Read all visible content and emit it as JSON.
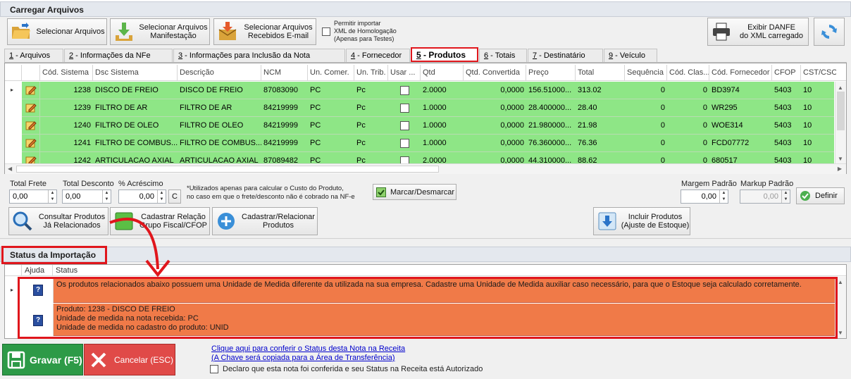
{
  "header": {
    "title": "Carregar Arquivos"
  },
  "toolbar": {
    "selecionar": "Selecionar Arquivos",
    "manifestacao": "Selecionar Arquivos\nManifestação",
    "email": "Selecionar Arquivos\nRecebidos E-mail",
    "permitir": "Permitir importar\nXML de Homologação\n(Apenas para Testes)",
    "danfe": "Exibir DANFE\ndo XML carregado"
  },
  "tabs": [
    {
      "num": "1",
      "label": " - Arquivos"
    },
    {
      "num": "2",
      "label": " - Informações da NFe"
    },
    {
      "num": "3",
      "label": " - Informações para Inclusão da Nota"
    },
    {
      "num": "4",
      "label": " - Fornecedor"
    },
    {
      "num": "5",
      "label": " - Produtos"
    },
    {
      "num": "6",
      "label": " - Totais"
    },
    {
      "num": "7",
      "label": " - Destinatário"
    },
    {
      "num": "9",
      "label": " - Veículo"
    }
  ],
  "grid": {
    "columns": [
      "Cód. Sistema",
      "Dsc Sistema",
      "Descrição",
      "NCM",
      "Un. Comer.",
      "Un. Trib.",
      "Usar ...",
      "Qtd",
      "Qtd. Convertida",
      "Preço",
      "Total",
      "Sequência",
      "Cód. Clas...",
      "Cód. Fornecedor",
      "CFOP",
      "CST/CSO..."
    ],
    "rows": [
      [
        "1238",
        "DISCO DE FREIO",
        "DISCO DE FREIO",
        "87083090",
        "PC",
        "Pc",
        "",
        "2.0000",
        "0,0000",
        "156.51000...",
        "313.02",
        "0",
        "0",
        "BD3974",
        "5403",
        "10"
      ],
      [
        "1239",
        "FILTRO DE AR",
        "FILTRO DE AR",
        "84219999",
        "PC",
        "Pc",
        "",
        "1.0000",
        "0,0000",
        "28.400000...",
        "28.40",
        "0",
        "0",
        "WR295",
        "5403",
        "10"
      ],
      [
        "1240",
        "FILTRO DE OLEO",
        "FILTRO DE OLEO",
        "84219999",
        "PC",
        "Pc",
        "",
        "1.0000",
        "0,0000",
        "21.980000...",
        "21.98",
        "0",
        "0",
        "WOE314",
        "5403",
        "10"
      ],
      [
        "1241",
        "FILTRO DE COMBUS...",
        "FILTRO DE COMBUS...",
        "84219999",
        "PC",
        "Pc",
        "",
        "1.0000",
        "0,0000",
        "76.360000...",
        "76.36",
        "0",
        "0",
        "FCD07772",
        "5403",
        "10"
      ],
      [
        "1242",
        "ARTICULACAO AXIAL",
        "ARTICULACAO AXIAL",
        "87089482",
        "PC",
        "Pc",
        "",
        "2.0000",
        "0,0000",
        "44.310000...",
        "88.62",
        "0",
        "0",
        "680517",
        "5403",
        "10"
      ]
    ]
  },
  "totals": {
    "frete_label": "Total Frete",
    "frete": "0,00",
    "desconto_label": "Total Desconto",
    "desconto": "0,00",
    "acrescimo_label": "% Acréscimo",
    "acrescimo": "0,00",
    "c_btn": "C",
    "note": "*Utilizados apenas para calcular o Custo do Produto,\nno caso em que o frete/desconto não é cobrado na NF-e",
    "marcar": "Marcar/Desmarcar",
    "margem_label": "Margem Padrão",
    "margem": "0,00",
    "markup_label": "Markup Padrão",
    "markup": "0,00",
    "definir": "Definir"
  },
  "actions": {
    "consultar": "Consultar Produtos\nJá Relacionados",
    "cadastrar_grupo": "Cadastrar Relação\nGrupo Fiscal/CFOP",
    "cadastrar_prod": "Cadastrar/Relacionar\nProdutos",
    "incluir": "Incluir Produtos\n(Ajuste de Estoque)"
  },
  "status": {
    "title": "Status da Importação",
    "col_ajuda": "Ajuda",
    "col_status": "Status",
    "rows": [
      "Os produtos relacionados abaixo possuem uma Unidade de Medida diferente da utilizada na sua empresa. Cadastre uma Unidade de Medida auxiliar caso necessário, para que o Estoque seja calculado corretamente.",
      "Produto: 1238 - DISCO DE FREIO\nUnidade de medida na nota recebida: PC\nUnidade de medida no cadastro do produto: UNID"
    ]
  },
  "footer": {
    "gravar": "Gravar (F5)",
    "cancelar": "Cancelar (ESC)",
    "link1": "Clique aqui para conferir o Status desta Nota na Receita",
    "link2": "(A Chave será copiada para a Área de Transferência)",
    "declaro": "Declaro que esta nota foi conferida e seu Status na Receita está Autorizado"
  },
  "colors": {
    "row_green": "#8ee686",
    "status_orange": "#f07a48",
    "highlight_red": "#e0161c",
    "gravar_green": "#2d9a47",
    "cancelar_red": "#e04a48"
  }
}
